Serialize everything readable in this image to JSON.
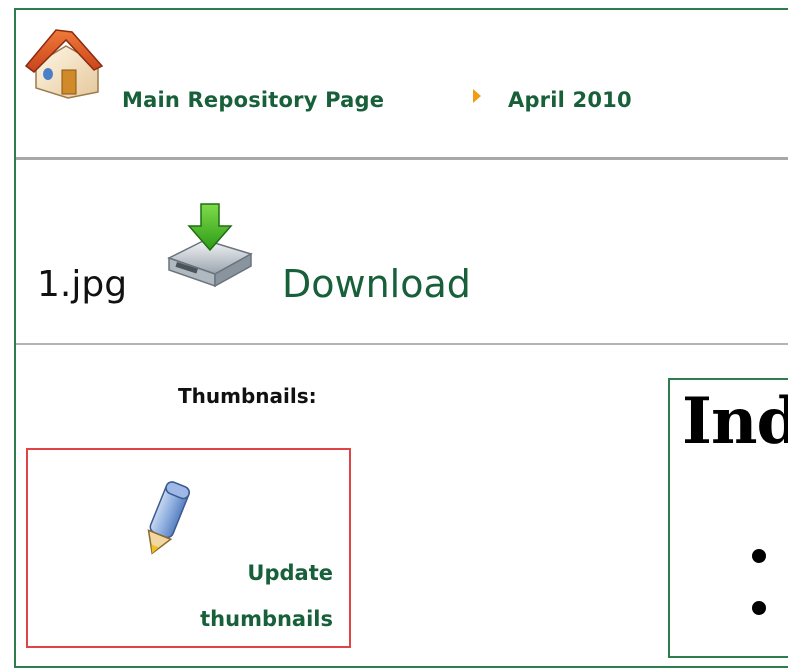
{
  "breadcrumb": {
    "home_icon": "house-icon",
    "separator_icon": "arrow-right-icon",
    "main": "Main Repository Page",
    "month": "April 2010"
  },
  "file": {
    "name": "1.jpg",
    "download_icon": "download-drive-icon",
    "download_label": "Download"
  },
  "thumbnails": {
    "label": "Thumbnails:",
    "edit_icon": "pencil-icon",
    "update_label_line1": "Update",
    "update_label_line2": "thumbnails"
  },
  "index_panel": {
    "heading": "Ind"
  },
  "colors": {
    "link": "#17603a",
    "frame": "#2e7d4f",
    "thumb_border": "#e04444",
    "separator": "#f39c12"
  }
}
